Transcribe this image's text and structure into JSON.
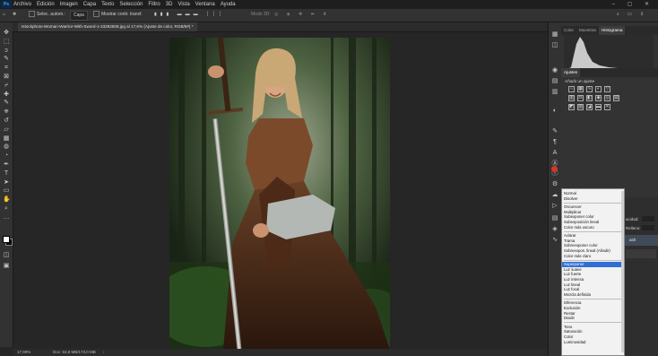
{
  "menu": {
    "logo": "Ps",
    "items": [
      "Archivo",
      "Edición",
      "Imagen",
      "Capa",
      "Texto",
      "Selección",
      "Filtro",
      "3D",
      "Vista",
      "Ventana",
      "Ayuda"
    ],
    "window_controls": "– ▢ ✕"
  },
  "options": {
    "autoselect_label": "Selec. autom.:",
    "autoselect_value": "Capa",
    "transform_label": "Mostrar contr. transf.",
    "mode3d_label": "Modo 3D:"
  },
  "document_tab": "Istockphoto-Woman-Warrior-With-Sword-1-23284508.jpg al 17,6% (Ajuste de color, RGB/8#) *",
  "status": {
    "zoom": "17,99%",
    "doc": "Doc: 53,8 MB/173,0 MB"
  },
  "panels": {
    "top_tabs": [
      "Color",
      "Muestras",
      "Histograma"
    ],
    "adjust_tab": "Ajustes",
    "adjust_hint": "Añadir un ajuste",
    "layer_fragments": [
      "acidad:",
      "Relleno:",
      "ash"
    ]
  },
  "blend_modes": {
    "groups": [
      [
        "Normal",
        "Disolver"
      ],
      [
        "Oscurecer",
        "Multiplicar",
        "Subexponer color",
        "Subexposición lineal",
        "Color más oscuro"
      ],
      [
        "Aclarar",
        "Trama",
        "Sobreexponer color",
        "Sobreexpos. lineal (Añadir)",
        "Color más claro"
      ],
      [
        "Superponer",
        "Luz suave",
        "Luz fuerte",
        "Luz intensa",
        "Luz lineal",
        "Luz focal",
        "Mezcla definida"
      ],
      [
        "Diferencia",
        "Exclusión",
        "Restar",
        "Dividir"
      ],
      [
        "Tono",
        "Saturación",
        "Color",
        "Luminosidad"
      ]
    ],
    "selected": "Superponer"
  },
  "colors": {
    "accent": "#2f6fd6",
    "ps_blue": "#31a8ff",
    "workspace": "#262626"
  }
}
